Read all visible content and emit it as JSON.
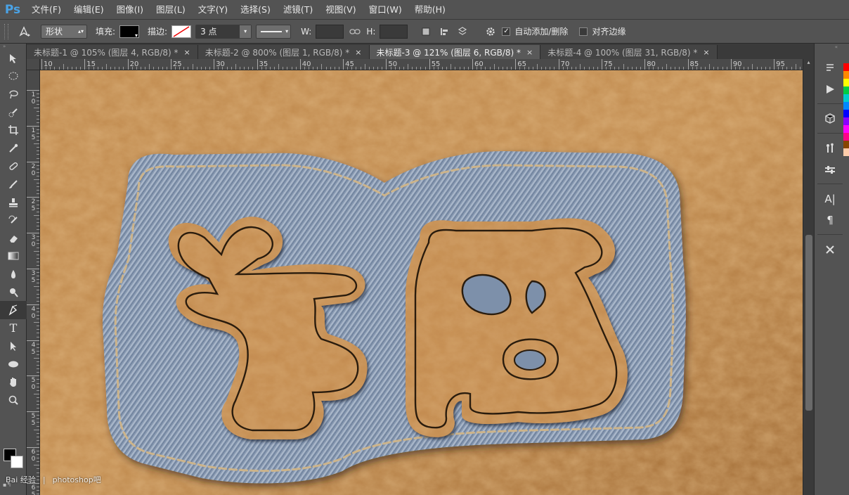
{
  "app": {
    "logo": "Ps",
    "menu": [
      "文件(F)",
      "编辑(E)",
      "图像(I)",
      "图层(L)",
      "文字(Y)",
      "选择(S)",
      "滤镜(T)",
      "视图(V)",
      "窗口(W)",
      "帮助(H)"
    ]
  },
  "options": {
    "mode": "形状",
    "fill_label": "填充:",
    "stroke_label": "描边:",
    "stroke_size": "3 点",
    "w_label": "W:",
    "h_label": "H:",
    "auto_add_delete": "自动添加/删除",
    "align_edges": "对齐边缘",
    "fill_color": "#000000",
    "auto_checked": true,
    "align_checked": false
  },
  "tabs": [
    {
      "label": "未标题-1 @ 105% (图层 4, RGB/8) *",
      "close": "×"
    },
    {
      "label": "未标题-2 @ 800% (图层 1, RGB/8) *",
      "close": "×"
    },
    {
      "label": "未标题-3 @ 121% (图层 6, RGB/8) *",
      "close": "×",
      "active": true
    },
    {
      "label": "未标题-4 @ 100% (图层 31, RGB/8) *",
      "close": "×"
    }
  ],
  "ruler": {
    "h_ticks": [
      "10",
      "15",
      "20",
      "25",
      "30",
      "35",
      "40",
      "45",
      "50",
      "55",
      "60",
      "65",
      "70",
      "75",
      "80",
      "85",
      "90",
      "95"
    ],
    "v_ticks": [
      "1\n0",
      "1\n5",
      "2\n0",
      "2\n5",
      "3\n0",
      "3\n5",
      "4\n0",
      "4\n5",
      "5\n0",
      "5\n5",
      "6\n0",
      "6\n5"
    ]
  },
  "watermark": {
    "left": "Bai 经验",
    "right": "photoshop吧"
  },
  "swatch_colors": [
    "#ff0000",
    "#ff8800",
    "#ffff00",
    "#00cc44",
    "#00cccc",
    "#0088ff",
    "#0000ff",
    "#8800ff",
    "#ff00ff",
    "#ff0088",
    "#884400",
    "#ffccaa"
  ]
}
